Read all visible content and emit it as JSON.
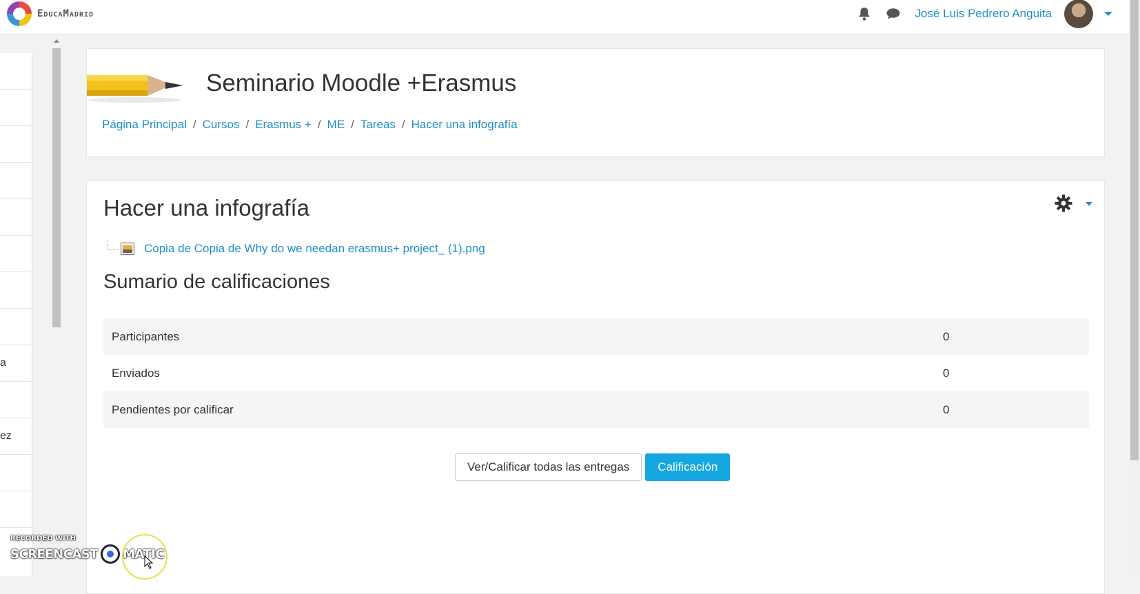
{
  "navbar": {
    "logo_text": "EducaMadrid",
    "user_name": "José Luis Pedrero Anguita",
    "icons": [
      "bell-icon",
      "chat-icon"
    ]
  },
  "drawer": {
    "items": [
      "",
      "",
      "",
      "",
      "",
      "",
      "",
      "",
      "a",
      "",
      "ez",
      "",
      ""
    ]
  },
  "header": {
    "course_title": "Seminario Moodle +Erasmus",
    "breadcrumb": [
      "Página Principal",
      "Cursos",
      "Erasmus +",
      "ME",
      "Tareas",
      "Hacer una infografía"
    ]
  },
  "assignment": {
    "title": "Hacer una infografía",
    "file_name": "Copia de Copia de Why do we needan erasmus+ project_ (1).png",
    "summary_title": "Sumario de calificaciones",
    "summary_rows": [
      {
        "label": "Participantes",
        "value": "0"
      },
      {
        "label": "Enviados",
        "value": "0"
      },
      {
        "label": "Pendientes por calificar",
        "value": "0"
      }
    ],
    "buttons": {
      "view_all": "Ver/Calificar todas las entregas",
      "grade": "Calificación"
    }
  },
  "watermark": {
    "line1": "RECORDED WITH",
    "brand_left": "SCREENCAST",
    "brand_right": "MATIC"
  },
  "colors": {
    "link": "#1f8fc7",
    "primary_button": "#15a8e0",
    "background": "#f2f2f2"
  }
}
